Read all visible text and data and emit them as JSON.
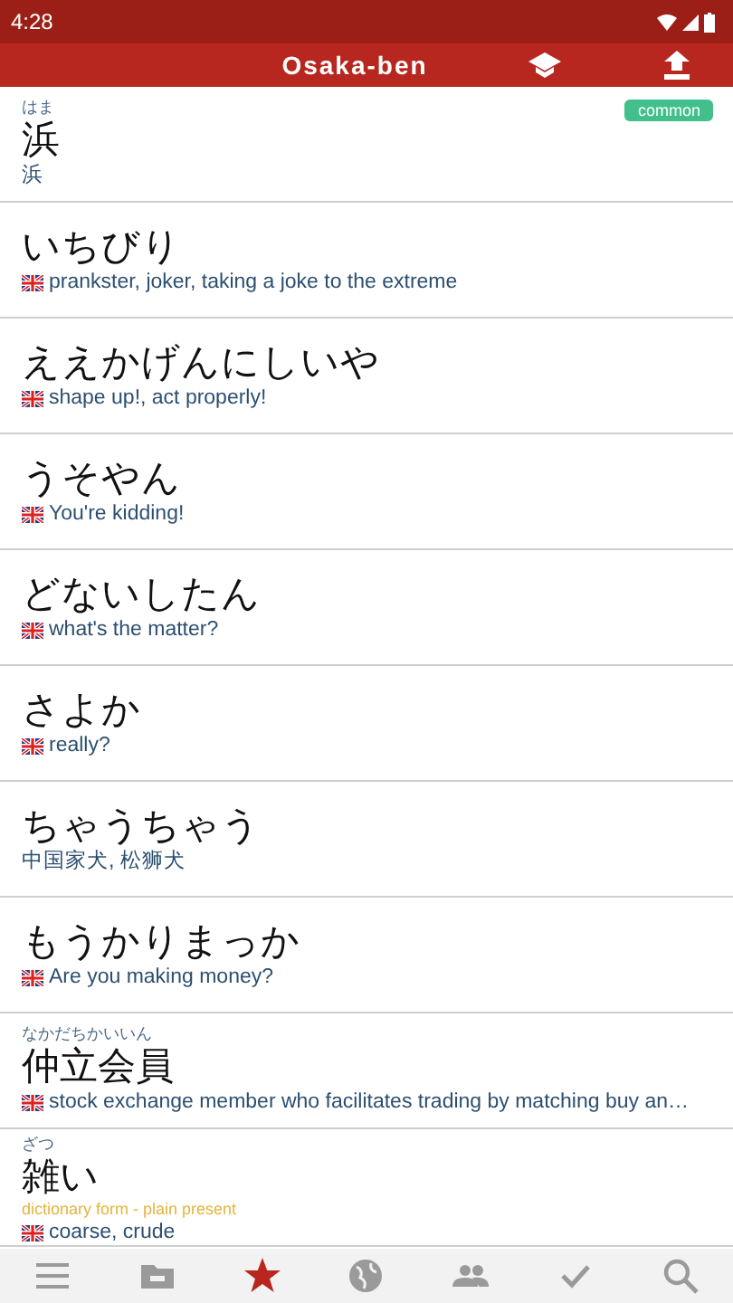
{
  "status_bar": {
    "time": "4:28"
  },
  "toolbar": {
    "title": "Osaka-ben"
  },
  "entries": [
    {
      "furigana": "はま",
      "word": "浜",
      "tag": "common",
      "gloss": "浜",
      "flag": false
    },
    {
      "word": "いちびり",
      "gloss": "prankster, joker, taking a joke to the extreme",
      "flag": true
    },
    {
      "word": "ええかげんにしいや",
      "gloss": "shape up!, act properly!",
      "flag": true
    },
    {
      "word": "うそやん",
      "gloss": "You're kidding!",
      "flag": true
    },
    {
      "word": "どないしたん",
      "gloss": "what's the matter?",
      "flag": true
    },
    {
      "word": "さよか",
      "gloss": "really?",
      "flag": true
    },
    {
      "word": "ちゃうちゃう",
      "gloss": "中国家犬, 松狮犬",
      "flag": false
    },
    {
      "word": "もうかりまっか",
      "gloss": "Are you making money?",
      "flag": true
    },
    {
      "furigana": "なかだちかいいん",
      "word": "仲立会員",
      "gloss": "stock exchange member who facilitates trading by matching buy an…",
      "flag": true
    },
    {
      "furigana": "ざつ",
      "word": "雑い",
      "form": "dictionary form - plain present",
      "gloss": "coarse, crude",
      "flag": true
    }
  ],
  "bottom_nav": [
    {
      "kind": "menu",
      "selected": false
    },
    {
      "kind": "folder",
      "selected": false
    },
    {
      "kind": "star",
      "selected": true
    },
    {
      "kind": "globe",
      "selected": false
    },
    {
      "kind": "people",
      "selected": false
    },
    {
      "kind": "check",
      "selected": false
    },
    {
      "kind": "search",
      "selected": false
    }
  ]
}
